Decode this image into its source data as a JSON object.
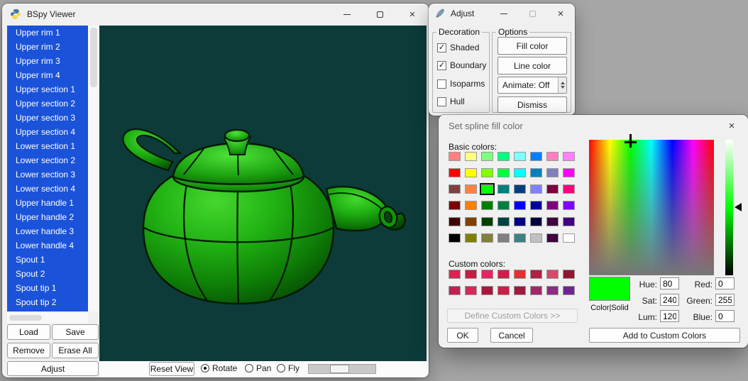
{
  "desktop_bg": "#a6a6a6",
  "viewer": {
    "title": "BSpy Viewer",
    "list_items": [
      "Upper rim 1",
      "Upper rim 2",
      "Upper rim 3",
      "Upper rim 4",
      "Upper section 1",
      "Upper section 2",
      "Upper section 3",
      "Upper section 4",
      "Lower section 1",
      "Lower section 2",
      "Lower section 3",
      "Lower section 4",
      "Upper handle 1",
      "Upper handle 2",
      "Lower handle 3",
      "Lower handle 4",
      "Spout 1",
      "Spout 2",
      "Spout tip 1",
      "Spout tip 2"
    ],
    "buttons": {
      "load": "Load",
      "save": "Save",
      "remove": "Remove",
      "erase_all": "Erase All",
      "adjust": "Adjust"
    },
    "bottom_bar": {
      "reset_view": "Reset View",
      "modes": [
        {
          "label": "Rotate",
          "selected": true
        },
        {
          "label": "Pan",
          "selected": false
        },
        {
          "label": "Fly",
          "selected": false
        }
      ]
    },
    "colors": {
      "list_bg": "#1a52d9",
      "canvas_bg": "#0c3b39",
      "teapot_green": "#1fae14"
    }
  },
  "adjust_window": {
    "title": "Adjust",
    "decoration_group": {
      "label": "Decoration",
      "checkboxes": [
        {
          "label": "Shaded",
          "checked": true
        },
        {
          "label": "Boundary",
          "checked": true
        },
        {
          "label": "Isoparms",
          "checked": false
        },
        {
          "label": "Hull",
          "checked": false
        }
      ]
    },
    "options_group": {
      "label": "Options",
      "fill_color": "Fill color",
      "line_color": "Line color",
      "animate": "Animate: Off",
      "dismiss": "Dismiss"
    }
  },
  "color_dialog": {
    "title": "Set spline fill color",
    "basic_colors_label": "Basic colors:",
    "basic_colors": [
      "#ff8080",
      "#ffff80",
      "#80ff80",
      "#00ff80",
      "#80ffff",
      "#0080ff",
      "#ff80c0",
      "#ff80ff",
      "#ff0000",
      "#ffff00",
      "#80ff00",
      "#00ff40",
      "#00ffff",
      "#0080c0",
      "#8080c0",
      "#ff00ff",
      "#804040",
      "#ff8040",
      "#00ff00",
      "#008080",
      "#004080",
      "#8080ff",
      "#800040",
      "#ff0080",
      "#800000",
      "#ff8000",
      "#008000",
      "#008040",
      "#0000ff",
      "#0000a0",
      "#800080",
      "#8000ff",
      "#400000",
      "#804000",
      "#004000",
      "#004040",
      "#000080",
      "#000040",
      "#400040",
      "#400080",
      "#000000",
      "#808000",
      "#808040",
      "#808080",
      "#408080",
      "#c0c0c0",
      "#400040",
      "#ffffff"
    ],
    "selected_basic_index": 18,
    "custom_colors_label": "Custom colors:",
    "custom_colors": [
      "#d6254f",
      "#c41e42",
      "#e02860",
      "#cc1f4a",
      "#e03030",
      "#b02040",
      "#d84868",
      "#8f1630",
      "#c22050",
      "#d42858",
      "#a81838",
      "#c81f46",
      "#9c1c3c",
      "#a02868",
      "#8c2c84",
      "#6e2590"
    ],
    "define_custom": "Define Custom Colors >>",
    "ok": "OK",
    "cancel": "Cancel",
    "color_solid_label": "Color|Solid",
    "preview_color": "#00ff00",
    "fields": {
      "hue_label": "Hue:",
      "hue": "80",
      "sat_label": "Sat:",
      "sat": "240",
      "lum_label": "Lum:",
      "lum": "120",
      "red_label": "Red:",
      "red": "0",
      "green_label": "Green:",
      "green": "255",
      "blue_label": "Blue:",
      "blue": "0"
    },
    "add_custom": "Add to Custom Colors"
  }
}
